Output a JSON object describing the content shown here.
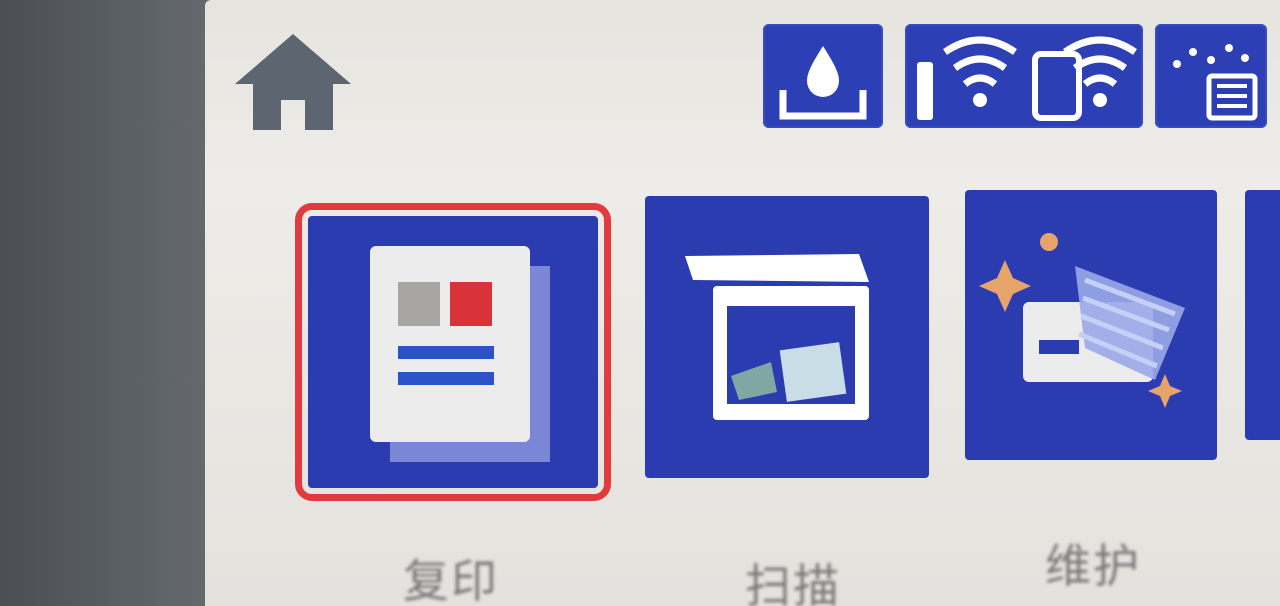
{
  "screen": {
    "bg_color": "#e6e4df",
    "accent_color": "#2b3bb0",
    "selection_color": "#e23b3f"
  },
  "header": {
    "home_icon": "home-icon",
    "status_icons": [
      {
        "name": "ink-level-icon"
      },
      {
        "name": "wifi-status-icon"
      },
      {
        "name": "wifi-direct-icon"
      }
    ]
  },
  "tiles": [
    {
      "name": "copy",
      "icon": "copy-document-icon",
      "label": "复印",
      "selected": true
    },
    {
      "name": "scan",
      "icon": "scanner-icon",
      "label": "扫描",
      "selected": false
    },
    {
      "name": "maintenance",
      "icon": "printer-maintenance-icon",
      "label": "维护",
      "selected": false
    }
  ]
}
